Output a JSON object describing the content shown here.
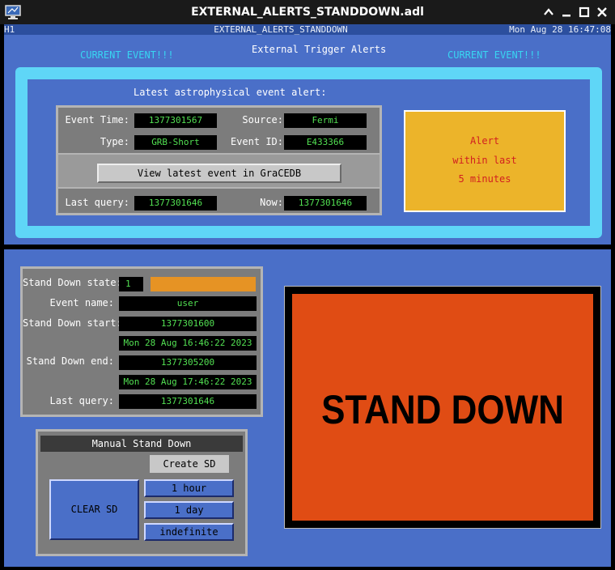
{
  "window": {
    "title": "EXTERNAL_ALERTS_STANDDOWN.adl"
  },
  "header": {
    "left": "H1",
    "center": "EXTERNAL_ALERTS_STANDDOWN",
    "datetime": "Mon Aug 28 16:47:08"
  },
  "top": {
    "current_event_left": "CURRENT EVENT!!!",
    "current_event_right": "CURRENT EVENT!!!",
    "title": "External Trigger Alerts",
    "subtitle": "Latest astrophysical event alert:"
  },
  "event": {
    "event_time_label": "Event Time:",
    "event_time": "1377301567",
    "source_label": "Source:",
    "source": "Fermi",
    "type_label": "Type:",
    "type": "GRB-Short",
    "event_id_label": "Event ID:",
    "event_id": "E433366",
    "view_button": "View latest event in GraCEDB",
    "last_query_label": "Last query:",
    "last_query": "1377301646",
    "now_label": "Now:",
    "now": "1377301646"
  },
  "alert_box": {
    "line1": "Alert",
    "line2": "within last",
    "line3": "5 minutes"
  },
  "standdown": {
    "state_label": "Stand Down state:",
    "state": "1",
    "event_name_label": "Event name:",
    "event_name": "user",
    "start_label": "Stand Down start:",
    "start_gps": "1377301600",
    "start_date": "Mon 28 Aug 16:46:22 2023",
    "end_label": "Stand Down end:",
    "end_gps": "1377305200",
    "end_date": "Mon 28 Aug 17:46:22 2023",
    "last_query_label": "Last query:",
    "last_query": "1377301646"
  },
  "manual": {
    "title": "Manual Stand Down",
    "create": "Create SD",
    "clear": "CLEAR SD",
    "opt_1h": "1 hour",
    "opt_1d": "1 day",
    "opt_indef": "indefinite"
  },
  "banner": {
    "text": "STAND DOWN"
  },
  "colors": {
    "background": "#4a6fc8",
    "alert_box": "#ecb42a",
    "alert_text": "#d22020",
    "state_indicator": "#e69324",
    "banner": "#e04c14",
    "field_text": "#52e052",
    "cyan": "#38d6f2"
  }
}
